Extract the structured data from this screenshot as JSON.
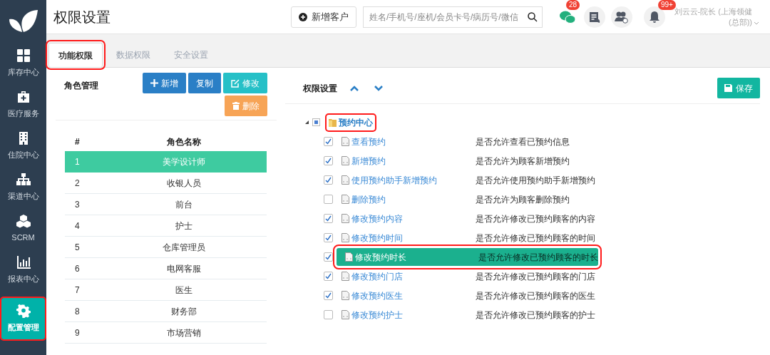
{
  "header": {
    "title": "权限设置",
    "add_button": "新增客户",
    "search": {
      "placeholder": "姓名/手机号/座机/会员卡号/病历号/微信"
    },
    "chat_badge": "28",
    "bell_badge": "99+",
    "user": "刘云云-院长 (上海领健(总部))"
  },
  "nav": [
    {
      "label": "库存中心",
      "kind": "grid",
      "selected": false,
      "highlighted": false
    },
    {
      "label": "医疗服务",
      "kind": "medkit",
      "selected": false,
      "highlighted": false
    },
    {
      "label": "住院中心",
      "kind": "building",
      "selected": false,
      "highlighted": false
    },
    {
      "label": "渠道中心",
      "kind": "sitemap",
      "selected": false,
      "highlighted": false
    },
    {
      "label": "SCRM",
      "kind": "cubes",
      "selected": false,
      "highlighted": false
    },
    {
      "label": "报表中心",
      "kind": "chart",
      "selected": false,
      "highlighted": false
    },
    {
      "label": "配置管理",
      "kind": "gear",
      "selected": true,
      "highlighted": true
    }
  ],
  "tabs": [
    {
      "label": "功能权限",
      "selected": true,
      "highlighted": true
    },
    {
      "label": "数据权限",
      "selected": false,
      "highlighted": false
    },
    {
      "label": "安全设置",
      "selected": false,
      "highlighted": false
    }
  ],
  "roles": {
    "title": "角色管理",
    "buttons": [
      {
        "label": "新增",
        "kind": "add"
      },
      {
        "label": "复制",
        "kind": "copy"
      },
      {
        "label": "修改",
        "kind": "edit"
      },
      {
        "label": "删除",
        "kind": "delete"
      }
    ],
    "columns": [
      "#",
      "角色名称"
    ],
    "rows": [
      {
        "num": "1",
        "name": "美学设计师",
        "selected": true
      },
      {
        "num": "2",
        "name": "收银人员",
        "selected": false
      },
      {
        "num": "3",
        "name": "前台",
        "selected": false
      },
      {
        "num": "4",
        "name": "护士",
        "selected": false
      },
      {
        "num": "5",
        "name": "仓库管理员",
        "selected": false
      },
      {
        "num": "6",
        "name": "电网客服",
        "selected": false
      },
      {
        "num": "7",
        "name": "医生",
        "selected": false
      },
      {
        "num": "8",
        "name": "财务部",
        "selected": false
      },
      {
        "num": "9",
        "name": "市场营销",
        "selected": false
      }
    ]
  },
  "permissions": {
    "title": "权限设置",
    "save": "保存",
    "group": {
      "label": "预约中心",
      "expanded": true,
      "partial": true,
      "highlighted": true,
      "children": [
        {
          "label": "查看预约",
          "description": "是否允许查看已预约信息",
          "checked": true,
          "selected": false
        },
        {
          "label": "新增预约",
          "description": "是否允许为顾客新增预约",
          "checked": true,
          "selected": false
        },
        {
          "label": "使用预约助手新增预约",
          "description": "是否允许使用预约助手新增预约",
          "checked": true,
          "selected": false
        },
        {
          "label": "删除预约",
          "description": "是否允许为顾客删除预约",
          "checked": false,
          "selected": false
        },
        {
          "label": "修改预约内容",
          "description": "是否允许修改已预约顾客的内容",
          "checked": true,
          "selected": false
        },
        {
          "label": "修改预约时间",
          "description": "是否允许修改已预约顾客的时间",
          "checked": true,
          "selected": false
        },
        {
          "label": "修改预约时长",
          "description": "是否允许修改已预约顾客的时长",
          "checked": true,
          "selected": true
        },
        {
          "label": "修改预约门店",
          "description": "是否允许修改已预约顾客的门店",
          "checked": true,
          "selected": false
        },
        {
          "label": "修改预约医生",
          "description": "是否允许修改已预约顾客的医生",
          "checked": true,
          "selected": false
        },
        {
          "label": "修改预约护士",
          "description": "是否允许修改已预约顾客的护士",
          "checked": false,
          "selected": false
        }
      ]
    }
  }
}
